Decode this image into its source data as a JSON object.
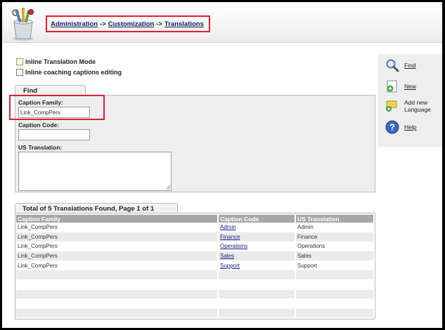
{
  "breadcrumb": {
    "items": [
      "Administration",
      "Customization",
      "Translations"
    ],
    "separator": "->"
  },
  "options": {
    "inline_translation_mode": "Inline Translation Mode",
    "inline_coaching": "Inline coaching captions editing"
  },
  "find": {
    "tab_label": "Find",
    "caption_family_label": "Caption Family:",
    "caption_family_value": "Link_CompPers",
    "caption_code_label": "Caption Code:",
    "caption_code_value": "",
    "us_translation_label": "US Translation:"
  },
  "results": {
    "tab_label": "Total of 5 Translations Found, Page 1 of 1",
    "columns": [
      "Caption Family",
      "Caption Code",
      "US Translation"
    ],
    "rows": [
      [
        "Link_CompPers",
        "Admin",
        "Admin"
      ],
      [
        "Link_CompPers",
        "Finance",
        "Finance"
      ],
      [
        "Link_CompPers",
        "Operations",
        "Operations"
      ],
      [
        "Link_CompPers",
        "Sales",
        "Sales"
      ],
      [
        "Link_CompPers",
        "Support",
        "Support"
      ]
    ]
  },
  "actions": {
    "find": "Find",
    "new": "New",
    "add_new_language_line1": "Add new",
    "add_new_language_line2": "Language",
    "help": "Help"
  },
  "icons": {
    "logo": "tools-cup-icon",
    "find": "magnifier-icon",
    "new": "new-document-icon",
    "add_language": "speech-bubble-add-icon",
    "help": "help-icon"
  },
  "colors": {
    "highlight": "#e0202c",
    "header_bg": "#f3f3f3",
    "table_header": "#a7a7a7",
    "link": "#1a1a80"
  }
}
